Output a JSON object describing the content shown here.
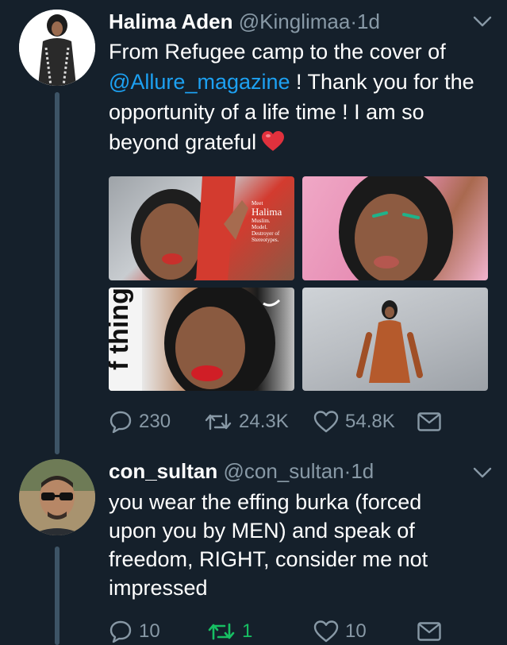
{
  "tweets": [
    {
      "display_name": "Halima Aden",
      "handle": "@Kinglimaa",
      "separator": "·",
      "time": "1d",
      "text_before": "From Refugee camp to the cover of ",
      "mention": "@Allure_magazine",
      "text_after": " ! Thank you for the opportunity of a life time ! I am so beyond grateful",
      "emoji": "heart-emoji",
      "media": {
        "cover_text": {
          "meet": "Meet",
          "name": "Halima",
          "lines": [
            "Muslim.",
            "Model.",
            "Destroyer of",
            "Stereotypes."
          ]
        },
        "things": "f things"
      },
      "counts": {
        "replies": "230",
        "retweets": "24.3K",
        "likes": "54.8K"
      }
    },
    {
      "display_name": "con_sultan",
      "handle": "@con_sultan",
      "separator": "·",
      "time": "1d",
      "text": "you wear the effing burka (forced upon you by MEN) and speak of freedom, RIGHT, consider me not impressed",
      "counts": {
        "replies": "10",
        "retweets": "1",
        "likes": "10"
      },
      "retweeted": true
    }
  ],
  "colors": {
    "background": "#15202b",
    "secondary_text": "#8899a6",
    "link": "#1da1f2",
    "retweet_active": "#17bf63",
    "thread_line": "#3d5466"
  }
}
